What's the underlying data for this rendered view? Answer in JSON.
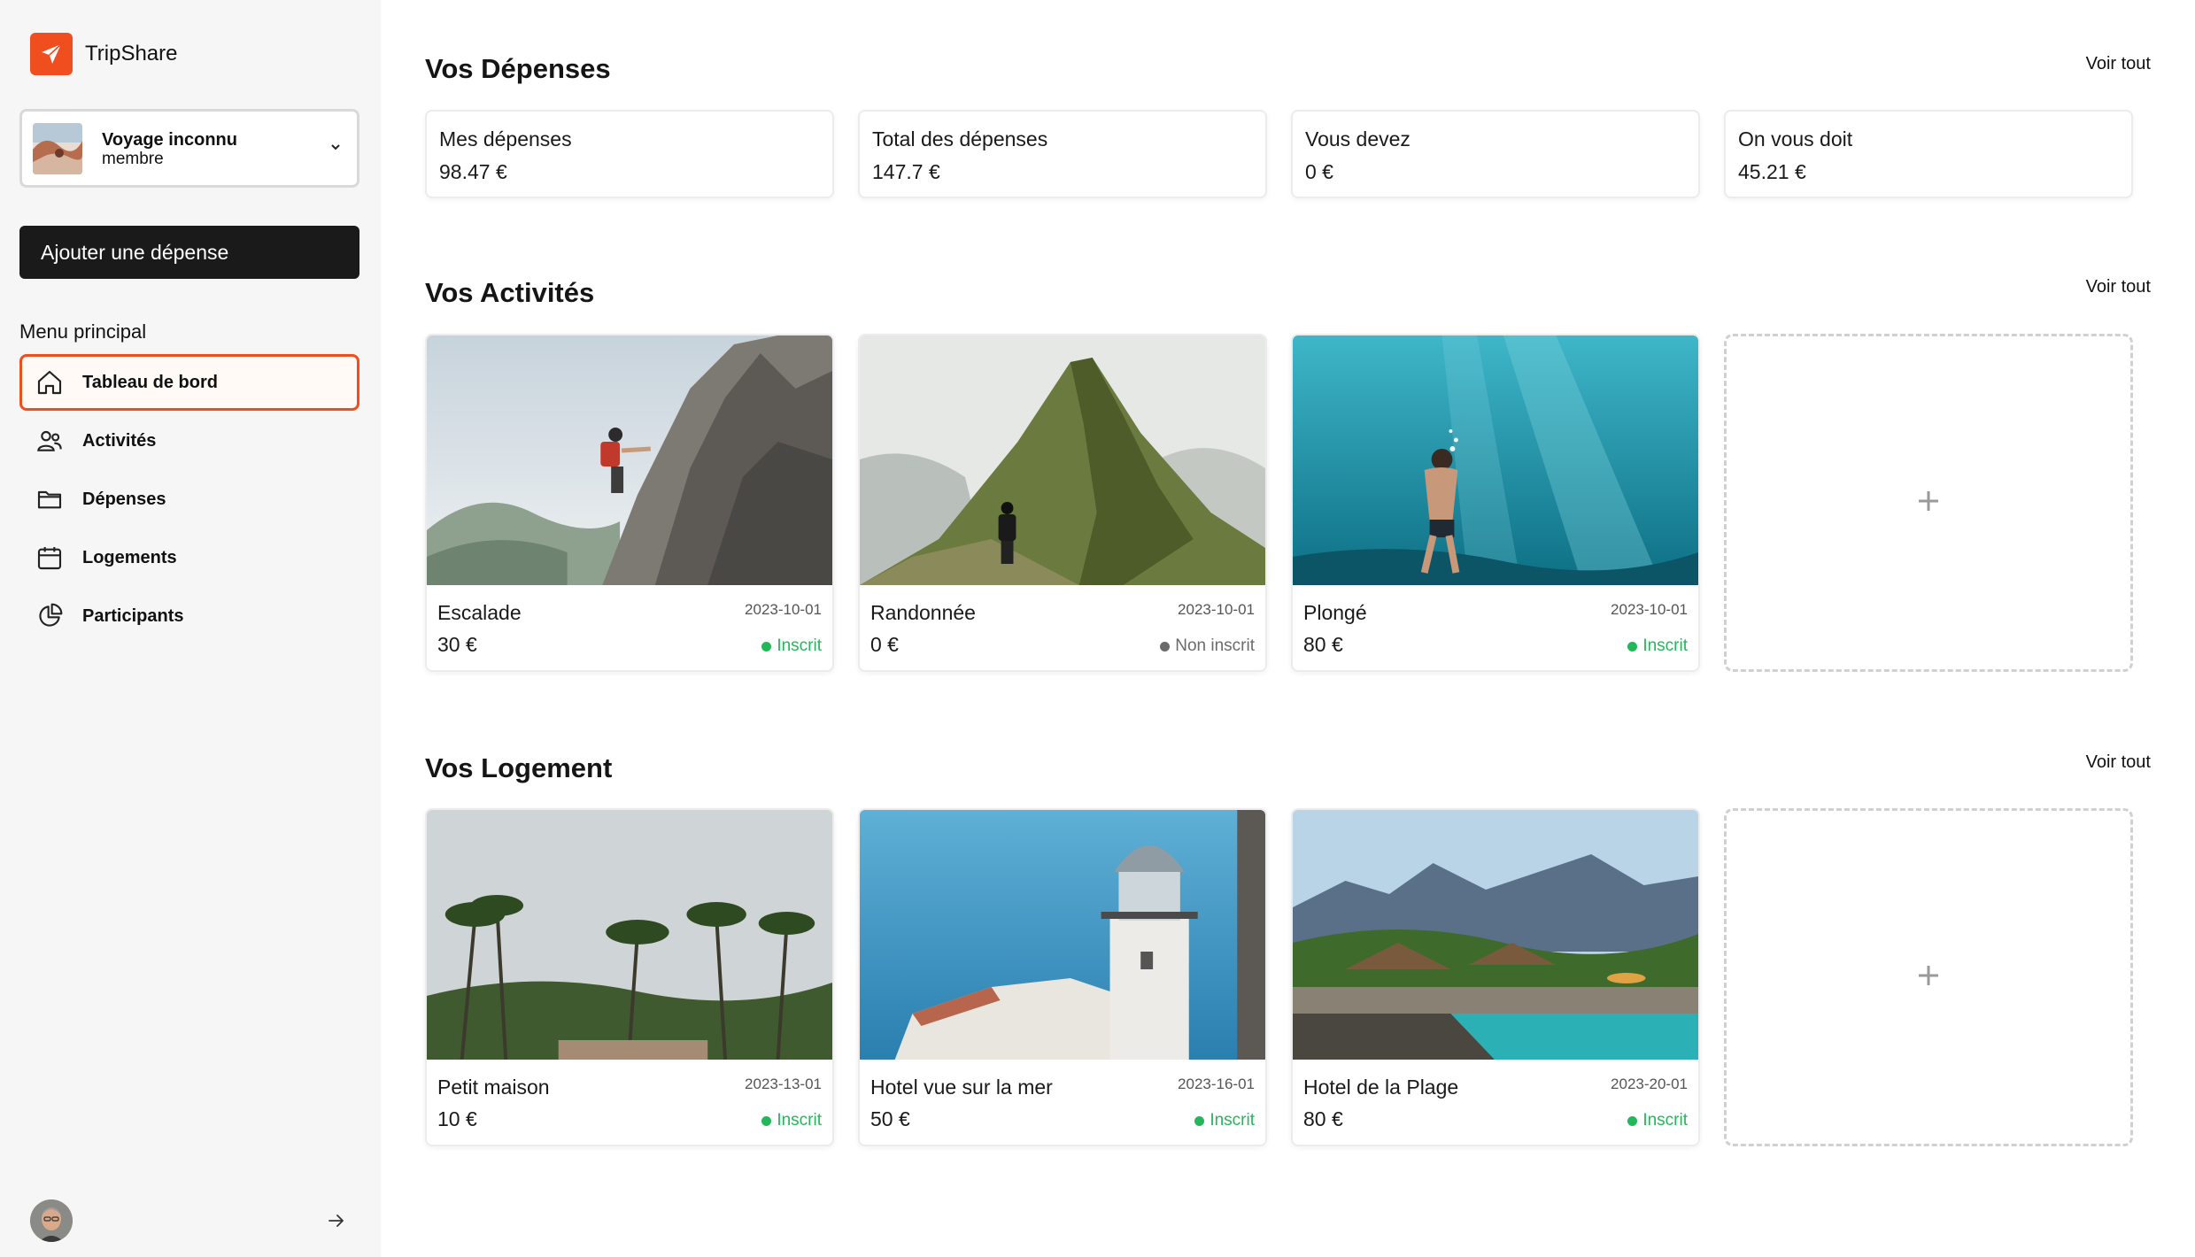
{
  "brand": {
    "name": "TripShare",
    "logo_icon": "paper-plane-icon",
    "accent": "#f04e1f"
  },
  "trip_selector": {
    "name": "Voyage inconnu",
    "role": "membre"
  },
  "sidebar": {
    "add_expense_label": "Ajouter une dépense",
    "menu_title": "Menu principal",
    "items": [
      {
        "label": "Tableau de bord",
        "icon": "home-icon",
        "active": true
      },
      {
        "label": "Activités",
        "icon": "users-icon",
        "active": false
      },
      {
        "label": "Dépenses",
        "icon": "folder-icon",
        "active": false
      },
      {
        "label": "Logements",
        "icon": "calendar-icon",
        "active": false
      },
      {
        "label": "Participants",
        "icon": "pie-chart-icon",
        "active": false
      }
    ]
  },
  "expenses": {
    "title": "Vos Dépenses",
    "see_all": "Voir tout",
    "stats": [
      {
        "label": "Mes dépenses",
        "value": "98.47 €"
      },
      {
        "label": "Total des dépenses",
        "value": "147.7 €"
      },
      {
        "label": "Vous devez",
        "value": "0 €"
      },
      {
        "label": "On vous doit",
        "value": "45.21 €"
      }
    ]
  },
  "activities": {
    "title": "Vos Activités",
    "see_all": "Voir tout",
    "items": [
      {
        "name": "Escalade",
        "date": "2023-10-01",
        "price": "30 €",
        "status": "Inscrit",
        "registered": true
      },
      {
        "name": "Randonnée",
        "date": "2023-10-01",
        "price": "0 €",
        "status": "Non inscrit",
        "registered": false
      },
      {
        "name": "Plongé",
        "date": "2023-10-01",
        "price": "80 €",
        "status": "Inscrit",
        "registered": true
      }
    ],
    "add_symbol": "+"
  },
  "lodgings": {
    "title": "Vos Logement",
    "see_all": "Voir tout",
    "items": [
      {
        "name": "Petit maison",
        "date": "2023-13-01",
        "price": "10 €",
        "status": "Inscrit",
        "registered": true
      },
      {
        "name": "Hotel vue sur la mer",
        "date": "2023-16-01",
        "price": "50 €",
        "status": "Inscrit",
        "registered": true
      },
      {
        "name": "Hotel de la Plage",
        "date": "2023-20-01",
        "price": "80 €",
        "status": "Inscrit",
        "registered": true
      }
    ],
    "add_symbol": "+"
  }
}
